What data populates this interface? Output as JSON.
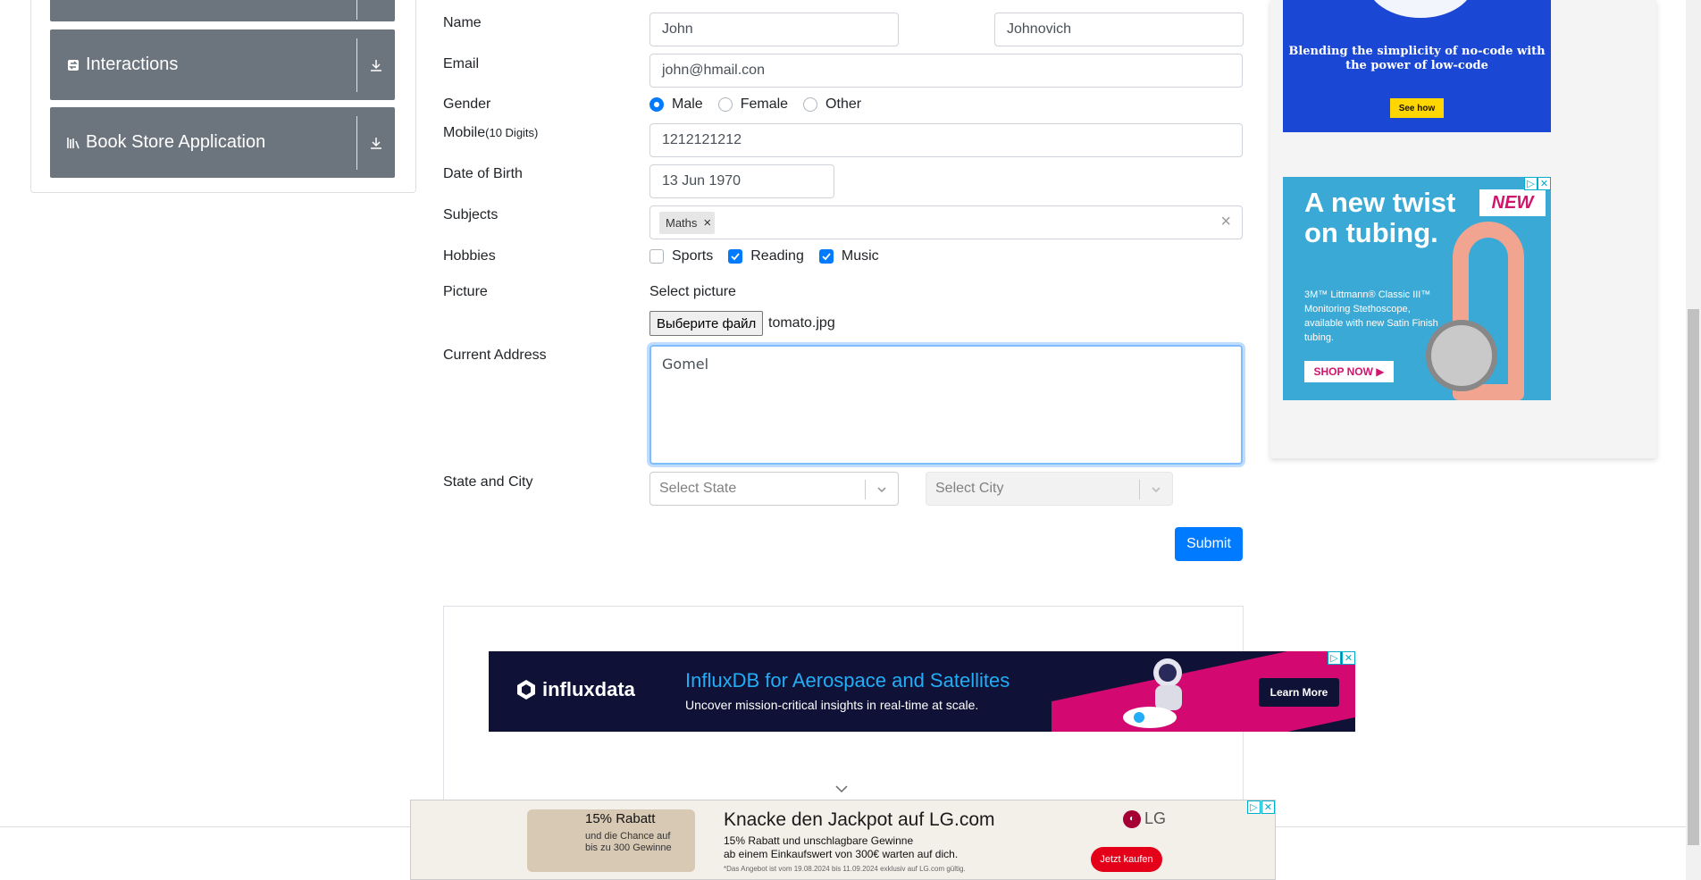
{
  "sidebar": {
    "groups": [
      {
        "label": "Interactions",
        "icon": "interactions-icon"
      },
      {
        "label": "Book Store Application",
        "icon": "book-icon"
      }
    ]
  },
  "form": {
    "name_label": "Name",
    "first_name": "John",
    "last_name": "Johnovich",
    "email_label": "Email",
    "email": "john@hmail.con",
    "gender_label": "Gender",
    "gender_options": [
      {
        "label": "Male",
        "checked": true
      },
      {
        "label": "Female",
        "checked": false
      },
      {
        "label": "Other",
        "checked": false
      }
    ],
    "mobile_label": "Mobile",
    "mobile_hint": "(10 Digits)",
    "mobile": "1212121212",
    "dob_label": "Date of Birth",
    "dob": "13 Jun 1970",
    "subjects_label": "Subjects",
    "subject_chip": "Maths",
    "subjects_clear": "×",
    "hobbies_label": "Hobbies",
    "hobbies": [
      {
        "label": "Sports",
        "checked": false
      },
      {
        "label": "Reading",
        "checked": true
      },
      {
        "label": "Music",
        "checked": true
      }
    ],
    "picture_label": "Picture",
    "select_picture": "Select picture",
    "file_button": "Выберите файл",
    "file_name": "tomato.jpg",
    "address_label": "Current Address",
    "address": "Gomel",
    "state_city_label": "State and City",
    "state_placeholder": "Select State",
    "city_placeholder": "Select City",
    "submit": "Submit"
  },
  "ads": {
    "influx": {
      "brand": "influxdata",
      "headline": "InfluxDB for Aerospace and Satellites",
      "subline": "Uncover mission-critical insights in real-time at scale.",
      "cta": "Learn More"
    },
    "lg": {
      "prize_title": "15% Rabatt",
      "prize_sub": "und die Chance auf bis zu 300 Gewinne",
      "headline": "Knacke den Jackpot auf LG.com",
      "line1": "15% Rabatt und unschlagbare Gewinne",
      "line2": "ab einem Einkaufswert von 300€ warten auf dich.",
      "fine": "*Das Angebot ist vom 19.08.2024 bis 11.09.2024 exklusiv auf LG.com gültig.",
      "logo": "LG",
      "cta": "Jetzt kaufen"
    },
    "nocode": {
      "text": "Blending the simplicity of no-code with the power of low-code",
      "cta": "See how"
    },
    "littmann": {
      "headline": "A new twist on tubing.",
      "body": "3M™ Littmann® Classic III™ Monitoring Stethoscope, available with new Satin Finish tubing.",
      "badge": "NEW",
      "cta": "SHOP NOW ▶"
    }
  },
  "colors": {
    "sidebar_header": "#6c757d",
    "primary": "#007bff"
  }
}
